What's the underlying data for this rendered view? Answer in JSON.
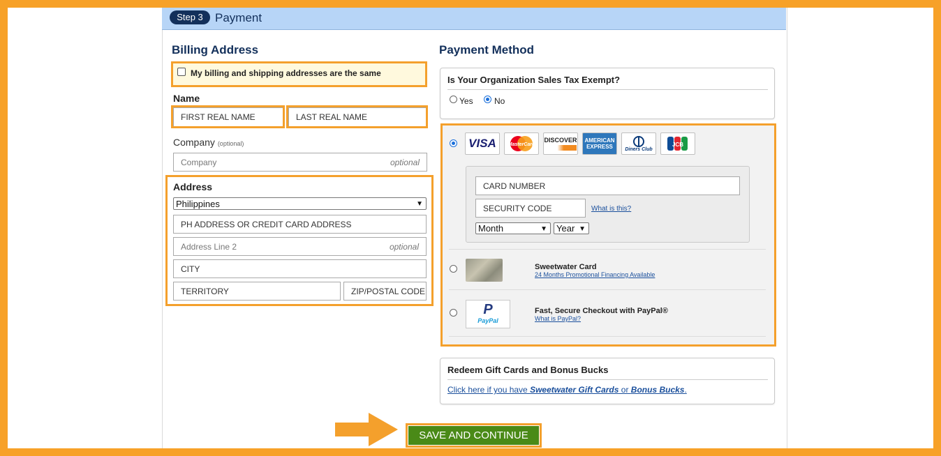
{
  "step": {
    "badge": "Step 3",
    "title": "Payment"
  },
  "billing": {
    "heading": "Billing Address",
    "same_address_label": "My billing and shipping addresses are the same",
    "name_label": "Name",
    "first_name_value": "FIRST REAL NAME",
    "last_name_value": "LAST REAL NAME",
    "company_label": "Company",
    "company_optional_note": "(optional)",
    "company_placeholder": "Company",
    "optional_text": "optional",
    "address_label": "Address",
    "country_value": "Philippines",
    "address1_value": "PH ADDRESS OR CREDIT CARD ADDRESS",
    "address2_placeholder": "Address Line 2",
    "city_value": "CITY",
    "territory_value": "TERRITORY",
    "zip_value": "ZIP/POSTAL CODE"
  },
  "payment": {
    "heading": "Payment Method",
    "tax_question": "Is Your Organization Sales Tax Exempt?",
    "tax_yes": "Yes",
    "tax_no": "No",
    "tax_selected": "No",
    "cards": [
      "VISA",
      "MasterCard",
      "DISCOVER",
      "AMERICAN EXPRESS",
      "Diners Club",
      "JCB"
    ],
    "card_number_value": "CARD NUMBER",
    "security_code_value": "SECURITY CODE",
    "what_is_this": "What is this?",
    "month_value": "Month",
    "year_value": "Year",
    "sweetwater_card_title": "Sweetwater Card",
    "sweetwater_card_link": "24 Months Promotional Financing Available",
    "paypal_title": "Fast, Secure Checkout with PayPal®",
    "paypal_link": "What is PayPal?",
    "paypal_logo_text": "PayPal"
  },
  "gift": {
    "heading": "Redeem Gift Cards and Bonus Bucks",
    "link_prefix": "Click here if you have ",
    "link_em1": "Sweetwater Gift Cards",
    "link_mid": " or ",
    "link_em2": "Bonus Bucks",
    "link_suffix": "."
  },
  "save_button": "SAVE AND CONTINUE",
  "colors": {
    "accent_orange": "#f4a02c",
    "header_blue": "#b7d5f7",
    "navy": "#13305b",
    "save_green": "#4a8a17"
  }
}
